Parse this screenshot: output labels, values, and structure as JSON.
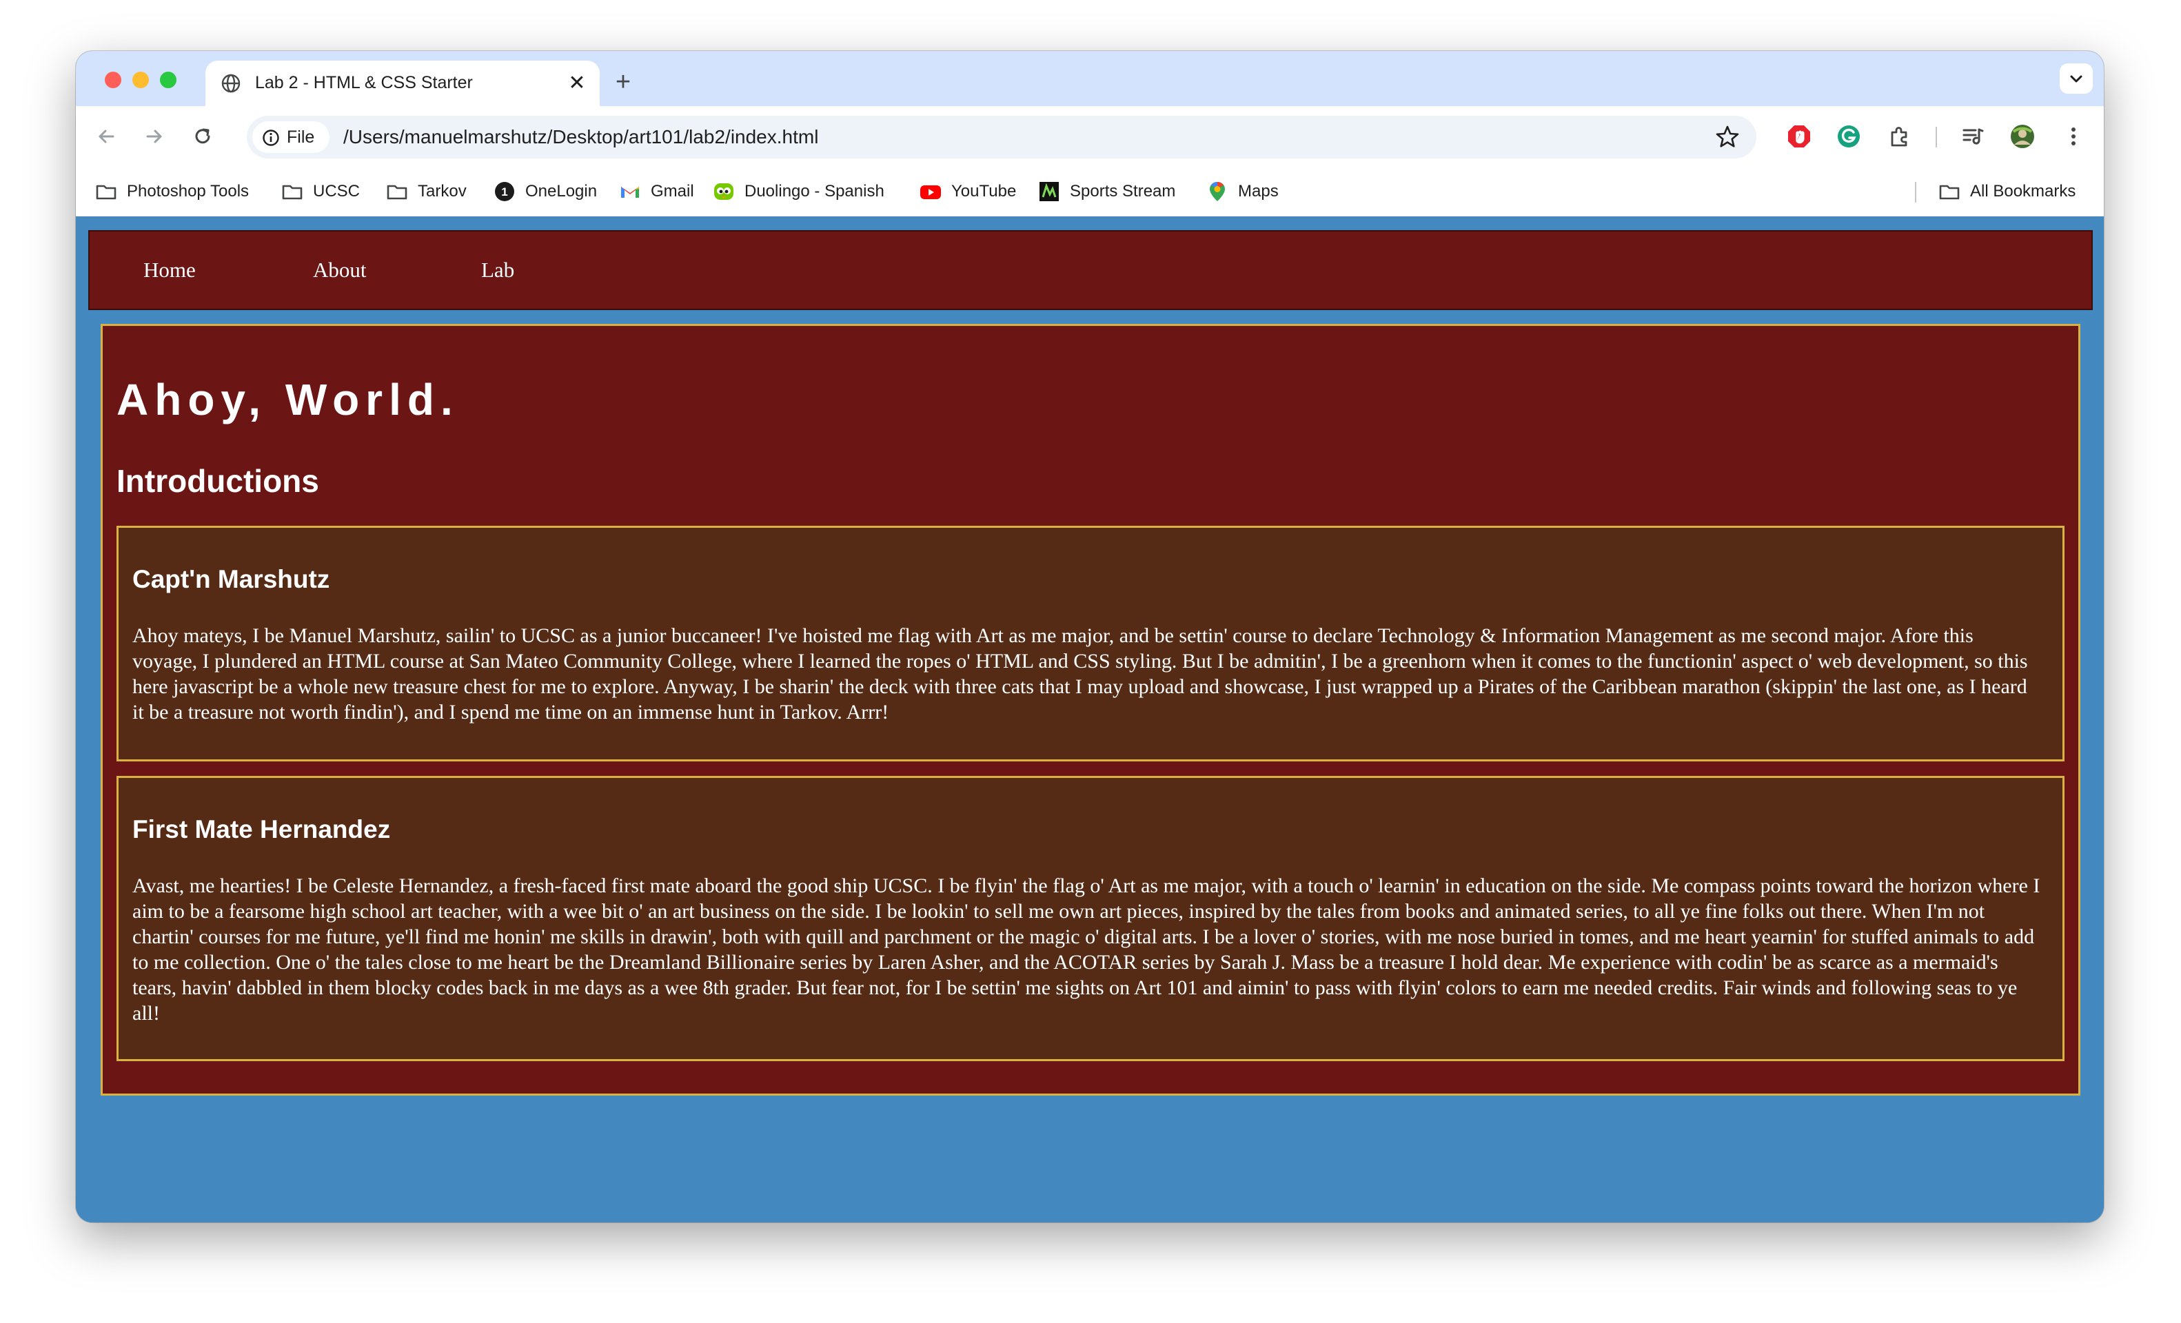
{
  "browser": {
    "tab": {
      "title": "Lab 2 - HTML & CSS Starter",
      "close_glyph": "✕",
      "favicon": "globe-icon"
    },
    "new_tab_glyph": "+",
    "omnibox": {
      "chip_label": "File",
      "url": "/Users/manuelmarshutz/Desktop/art101/lab2/index.html"
    },
    "bookmarks": [
      {
        "label": "Photoshop Tools",
        "icon": "folder-icon"
      },
      {
        "label": "UCSC",
        "icon": "folder-icon"
      },
      {
        "label": "Tarkov",
        "icon": "folder-icon"
      },
      {
        "label": "OneLogin",
        "icon": "onelogin-icon"
      },
      {
        "label": "Gmail",
        "icon": "gmail-icon"
      },
      {
        "label": "Duolingo - Spanish",
        "icon": "duolingo-icon"
      },
      {
        "label": "YouTube",
        "icon": "youtube-icon"
      },
      {
        "label": "Sports Stream",
        "icon": "sports-stream-icon"
      },
      {
        "label": "Maps",
        "icon": "maps-icon"
      }
    ],
    "all_bookmarks_label": "All Bookmarks",
    "onelogin_glyph": "1"
  },
  "site": {
    "nav": [
      {
        "label": "Home"
      },
      {
        "label": "About"
      },
      {
        "label": "Lab"
      }
    ],
    "title": "Ahoy, World.",
    "section_heading": "Introductions",
    "people": [
      {
        "name": "Capt'n Marshutz",
        "bio": "Ahoy mateys, I be Manuel Marshutz, sailin' to UCSC as a junior buccaneer! I've hoisted me flag with Art as me major, and be settin' course to declare Technology & Information Management as me second major. Afore this voyage, I plundered an HTML course at San Mateo Community College, where I learned the ropes o' HTML and CSS styling. But I be admitin', I be a greenhorn when it comes to the functionin' aspect o' web development, so this here javascript be a whole new treasure chest for me to explore. Anyway, I be sharin' the deck with three cats that I may upload and showcase, I just wrapped up a Pirates of the Caribbean marathon (skippin' the last one, as I heard it be a treasure not worth findin'), and I spend me time on an immense hunt in Tarkov. Arrr!"
      },
      {
        "name": "First Mate Hernandez",
        "bio": "Avast, me hearties! I be Celeste Hernandez, a fresh-faced first mate aboard the good ship UCSC. I be flyin' the flag o' Art as me major, with a touch o' learnin' in education on the side. Me compass points toward the horizon where I aim to be a fearsome high school art teacher, with a wee bit o' an art business on the side. I be lookin' to sell me own art pieces, inspired by the tales from books and animated series, to all ye fine folks out there. When I'm not chartin' courses for me future, ye'll find me honin' me skills in drawin', both with quill and parchment or the magic o' digital arts. I be a lover o' stories, with me nose buried in tomes, and me heart yearnin' for stuffed animals to add to me collection. One o' the tales close to me heart be the Dreamland Billionaire series by Laren Asher, and the ACOTAR series by Sarah J. Mass be a treasure I hold dear. Me experience with codin' be as scarce as a mermaid's tears, havin' dabbled in them blocky codes back in me days as a wee 8th grader. But fear not, for I be settin' me sights on Art 101 and aimin' to pass with flyin' colors to earn me needed credits. Fair winds and following seas to ye all!"
      }
    ]
  },
  "colors": {
    "page_background": "#4389bf",
    "nav_background": "#6b1515",
    "card_background": "#6b1515",
    "person_card_background": "#552b16",
    "card_border": "#d9b23f",
    "text": "#ffffff"
  }
}
